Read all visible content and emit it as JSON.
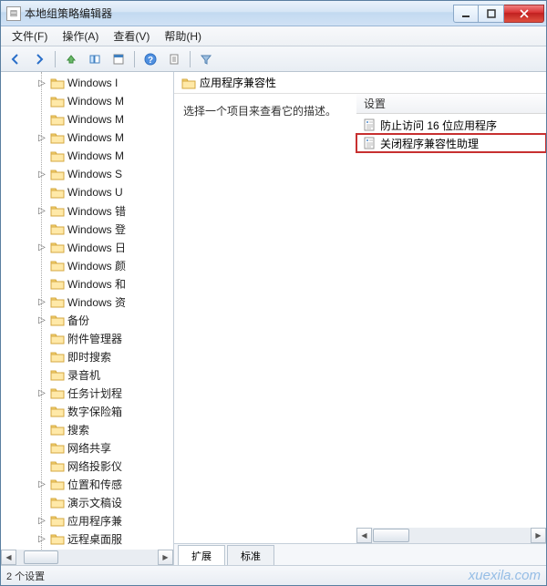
{
  "window": {
    "title": "本地组策略编辑器"
  },
  "menu": {
    "file": "文件(F)",
    "action": "操作(A)",
    "view": "查看(V)",
    "help": "帮助(H)"
  },
  "tree": {
    "items": [
      {
        "label": "Windows I",
        "exp": "▷"
      },
      {
        "label": "Windows M"
      },
      {
        "label": "Windows M"
      },
      {
        "label": "Windows M",
        "exp": "▷"
      },
      {
        "label": "Windows M"
      },
      {
        "label": "Windows S",
        "exp": "▷"
      },
      {
        "label": "Windows U"
      },
      {
        "label": "Windows 错",
        "exp": "▷"
      },
      {
        "label": "Windows 登"
      },
      {
        "label": "Windows 日",
        "exp": "▷"
      },
      {
        "label": "Windows 颜"
      },
      {
        "label": "Windows 和"
      },
      {
        "label": "Windows 资",
        "exp": "▷"
      },
      {
        "label": "备份",
        "exp": "▷"
      },
      {
        "label": "附件管理器"
      },
      {
        "label": "即时搜索"
      },
      {
        "label": "录音机"
      },
      {
        "label": "任务计划程",
        "exp": "▷"
      },
      {
        "label": "数字保险箱"
      },
      {
        "label": "搜索"
      },
      {
        "label": "网络共享"
      },
      {
        "label": "网络投影仪"
      },
      {
        "label": "位置和传感",
        "exp": "▷"
      },
      {
        "label": "演示文稿设"
      },
      {
        "label": "应用程序兼",
        "exp": "▷"
      },
      {
        "label": "远程桌面服",
        "exp": "▷"
      }
    ]
  },
  "right": {
    "header": "应用程序兼容性",
    "desc": "选择一个项目来查看它的描述。",
    "colhdr": "设置",
    "items": [
      {
        "label": "防止访问 16 位应用程序",
        "hl": false
      },
      {
        "label": "关闭程序兼容性助理",
        "hl": true
      }
    ],
    "tabs": {
      "ext": "扩展",
      "std": "标准"
    }
  },
  "status": {
    "text": "2 个设置"
  },
  "watermark": "xuexila.com"
}
